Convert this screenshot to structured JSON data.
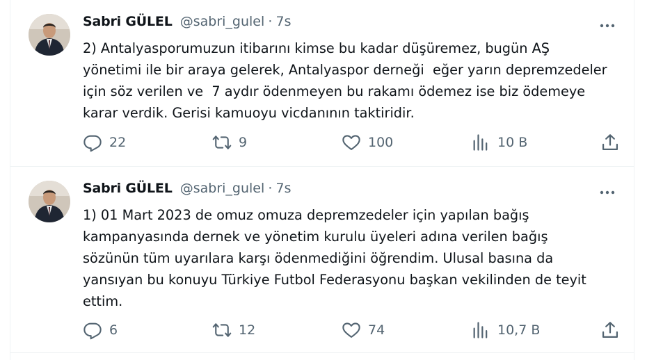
{
  "tweets": [
    {
      "author_name": "Sabri GÜLEL",
      "handle": "@sabri_gulel",
      "separator": "·",
      "time": "7s",
      "text": "2) Antalyasporumuzun itibarını kimse bu kadar düşüremez, bugün AŞ\nyönetimi ile bir araya gelerek, Antalyaspor derneği  eğer yarın depremzedeler\niçin söz verilen ve  7 aydır ödenmeyen bu rakamı ödemez ise biz ödemeye\nkarar verdik. Gerisi kamuoyu vicdanının taktiridir.",
      "replies": "22",
      "retweets": "9",
      "likes": "100",
      "views": "10 B"
    },
    {
      "author_name": "Sabri GÜLEL",
      "handle": "@sabri_gulel",
      "separator": "·",
      "time": "7s",
      "text": "1) 01 Mart 2023 de omuz omuza depremzedeler için yapılan bağış\nkampanyasında dernek ve yönetim kurulu üyeleri adına verilen bağış\nsözünün tüm uyarılara karşı ödenmediğini öğrendim. Ulusal basına da\nyansıyan bu konuyu Türkiye Futbol Federasyonu başkan vekilinden de teyit\nettim.",
      "replies": "6",
      "retweets": "12",
      "likes": "74",
      "views": "10,7 B"
    }
  ],
  "icons": {
    "avatar": "avatar",
    "more": "more-icon",
    "reply": "reply-icon",
    "retweet": "retweet-icon",
    "like": "heart-icon",
    "views": "views-icon",
    "share": "share-icon"
  },
  "colors": {
    "text": "#0f1419",
    "secondary": "#536471",
    "border": "#eff3f4"
  }
}
